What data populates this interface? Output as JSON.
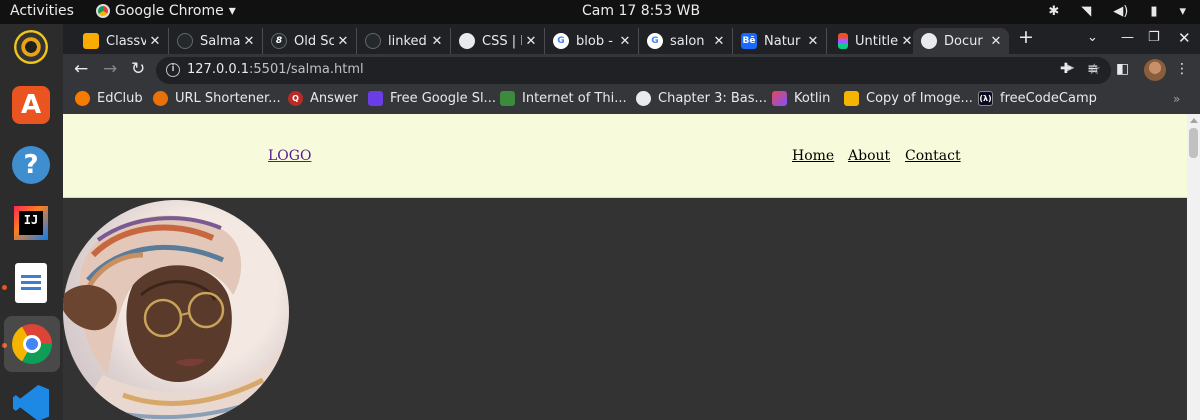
{
  "system": {
    "activities": "Activities",
    "app_name": "Google Chrome",
    "clock": "Cam 17   8:53 WB"
  },
  "tabs": [
    {
      "label": "Classv",
      "favicon": "classroom-icon",
      "color": "#f9ab00"
    },
    {
      "label": "Salma",
      "favicon": "github-icon",
      "color": "#24292e"
    },
    {
      "label": "Old Sc",
      "favicon": "bootstrap-icon",
      "color": "#24292e"
    },
    {
      "label": "linked",
      "favicon": "github-icon",
      "color": "#24292e"
    },
    {
      "label": "CSS | li",
      "favicon": "globe-icon",
      "color": "#5f6368"
    },
    {
      "label": "blob -",
      "favicon": "google-icon",
      "color": "#ffffff"
    },
    {
      "label": "salon",
      "favicon": "google-icon",
      "color": "#ffffff"
    },
    {
      "label": "Natur",
      "favicon": "behance-icon",
      "color": "#1769ff"
    },
    {
      "label": "Untitle",
      "favicon": "figma-icon",
      "color": "#a259ff"
    },
    {
      "label": "Docur",
      "favicon": "globe-icon",
      "color": "#5f6368",
      "active": true
    }
  ],
  "address_bar": {
    "host": "127.0.0.1",
    "path": ":5501/salma.html"
  },
  "bookmarks": [
    {
      "label": "EdClub",
      "favicon": "edclub-icon",
      "color": "#f57c00"
    },
    {
      "label": "URL Shortener...",
      "favicon": "url-shortener-icon",
      "color": "#e8710a"
    },
    {
      "label": "Answer",
      "favicon": "quora-icon",
      "color": "#b92b27"
    },
    {
      "label": "Free Google Sl...",
      "favicon": "slidesgo-icon",
      "color": "#6a3de8"
    },
    {
      "label": "Internet of Thi...",
      "favicon": "iot-icon",
      "color": "#3c8a3c"
    },
    {
      "label": "Chapter 3: Bas...",
      "favicon": "globe-icon",
      "color": "#5f6368"
    },
    {
      "label": "Kotlin",
      "favicon": "kotlin-icon",
      "color": "#7f52ff"
    },
    {
      "label": "Copy of Imoge...",
      "favicon": "slides-icon",
      "color": "#f4b400"
    },
    {
      "label": "freeCodeCamp",
      "favicon": "freecodecamp-icon",
      "color": "#0a0a23"
    }
  ],
  "page": {
    "logo": "LOGO",
    "nav": [
      "Home",
      "About",
      "Contact"
    ],
    "header_bg": "#f7fbdc",
    "body_bg": "#333333"
  }
}
